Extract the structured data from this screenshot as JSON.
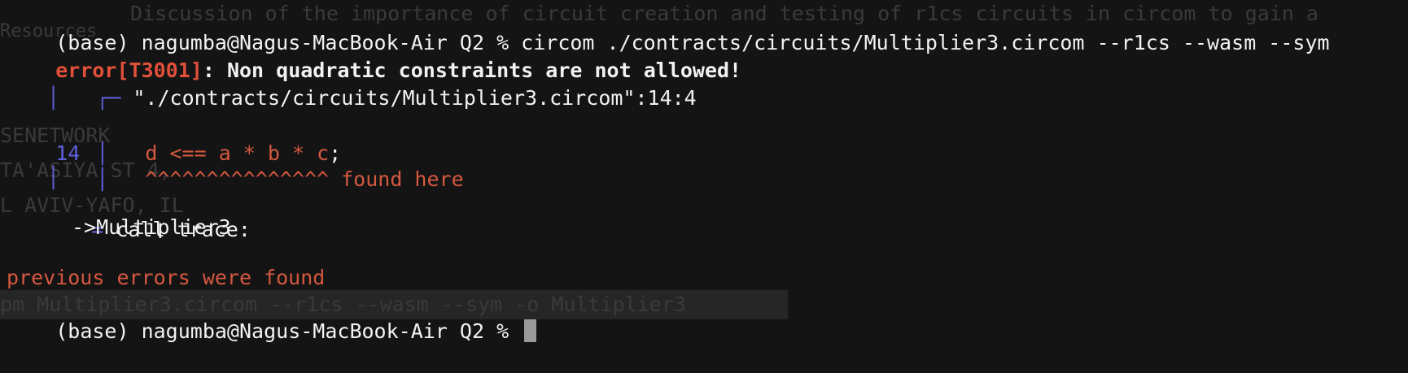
{
  "background_ghost": {
    "lines": [
      "Discussion of the importance of circuit creation and testing of r1cs circuits in circom to gain a",
      "Resources",
      "SENETWORK",
      "TA'ASIYA ST 4,",
      "L AVIV-YAFO, IL",
      "pm Multiplier3.circom --r1cs --wasm --sym -o Multiplier3"
    ]
  },
  "terminal": {
    "prompt": "(base) nagumba@Nagus-MacBook-Air Q2 % ",
    "command": "circom ./contracts/circuits/Multiplier3.circom --r1cs --wasm --sym",
    "error_code": "error[T3001]",
    "error_message": ": Non quadratic constraints are not allowed!",
    "location_prefix": "┌─ ",
    "location": "\"./contracts/circuits/Multiplier3.circom\":14:4",
    "gutter_pipe": "│",
    "line_number": "14",
    "source_code": "d <== a * b * c",
    "source_semicolon": ";",
    "carets": "^^^^^^^^^^^^^^^",
    "found_here": " found here",
    "trace_equals": "=",
    "trace_label": " call trace:",
    "trace_item": "->Multiplier3",
    "summary": "previous errors were found",
    "final_prompt": "(base) nagumba@Nagus-MacBook-Air Q2 % "
  },
  "colors": {
    "background": "#141414",
    "error_red": "#e0503a",
    "gutter_blue": "#5f5fdc",
    "text": "#f2f2f2"
  }
}
